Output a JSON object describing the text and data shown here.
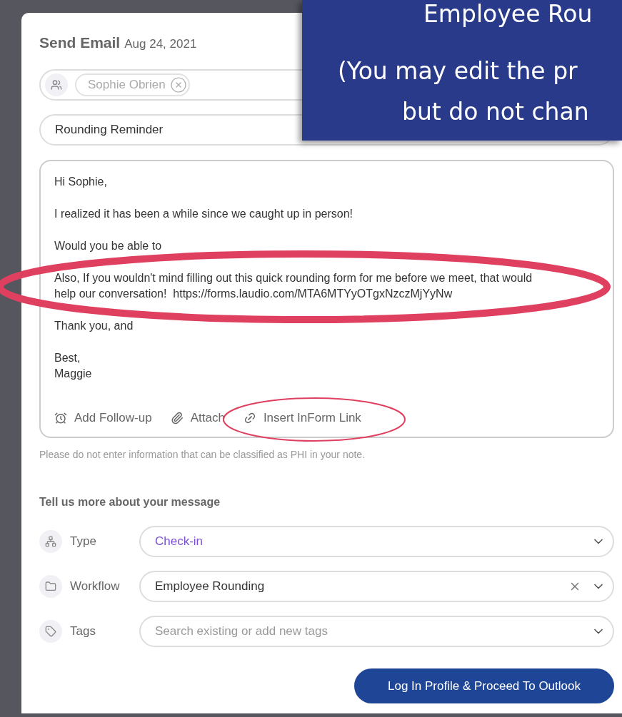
{
  "header": {
    "title": "Send Email",
    "date": "Aug 24, 2021"
  },
  "recipients": [
    {
      "name": "Sophie Obrien"
    }
  ],
  "subject": {
    "value": "Rounding Reminder"
  },
  "body": {
    "paragraphs": [
      [
        "Hi Sophie,"
      ],
      [
        "I realized it has been a while since we caught up in person!"
      ],
      [
        "Would you be able to"
      ],
      [
        "Also, If you wouldn't mind filling out this quick rounding form for me before we meet, that would",
        "help our conversation!  https://forms.laudio.com/MTA6MTYyOTgxNzczMjYyNw"
      ],
      [
        "Thank you, and"
      ],
      [
        "Best,",
        "Maggie"
      ]
    ]
  },
  "body_actions": [
    {
      "kind": "follow-up",
      "label": "Add Follow-up"
    },
    {
      "kind": "attach",
      "label": "Attach"
    },
    {
      "kind": "link",
      "label": "Insert InForm Link"
    }
  ],
  "hint": "Please do not enter information that can be classified as PHI in your note.",
  "details": {
    "title": "Tell us more about your message",
    "fields": [
      {
        "kind": "type",
        "label": "Type",
        "value": "Check-in",
        "clearable": false
      },
      {
        "kind": "workflow",
        "label": "Workflow",
        "value": "Employee Rounding",
        "clearable": true
      },
      {
        "kind": "tags",
        "label": "Tags",
        "placeholder": "Search existing or add new tags",
        "clearable": false
      }
    ]
  },
  "primary_button": "Log In Profile & Proceed To Outlook",
  "callout": {
    "lines": [
      "Employee Rou",
      "(You may edit the pr",
      "but do not chan"
    ]
  }
}
